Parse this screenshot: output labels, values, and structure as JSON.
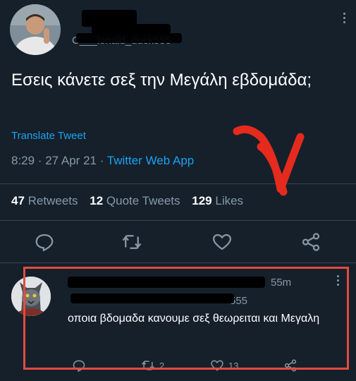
{
  "tweet": {
    "handle_fragment": "C___lonald_duck555",
    "text": "Εσεις κάνετε σεξ την Μεγάλη εβδομάδα;",
    "translate_label": "Translate Tweet",
    "time": "8:29 · 27 Apr 21 · ",
    "source": "Twitter Web App",
    "stats": {
      "retweets_count": "47",
      "retweets_label": "Retweets",
      "quotes_count": "12",
      "quotes_label": "Quote Tweets",
      "likes_count": "129",
      "likes_label": "Likes"
    },
    "actions": [
      "reply-icon",
      "retweet-icon",
      "like-icon",
      "share-icon"
    ]
  },
  "reply": {
    "time": "55m",
    "handle_fragment": "555",
    "text": "οποια βδομαδα κανουμε σεξ θεωρειται και Μεγαλη",
    "retweets": "2",
    "likes": "13"
  },
  "colors": {
    "background": "#15202b",
    "accent": "#1da1f2",
    "secondary_text": "#8899a6",
    "annotation": "#e34b3e"
  }
}
